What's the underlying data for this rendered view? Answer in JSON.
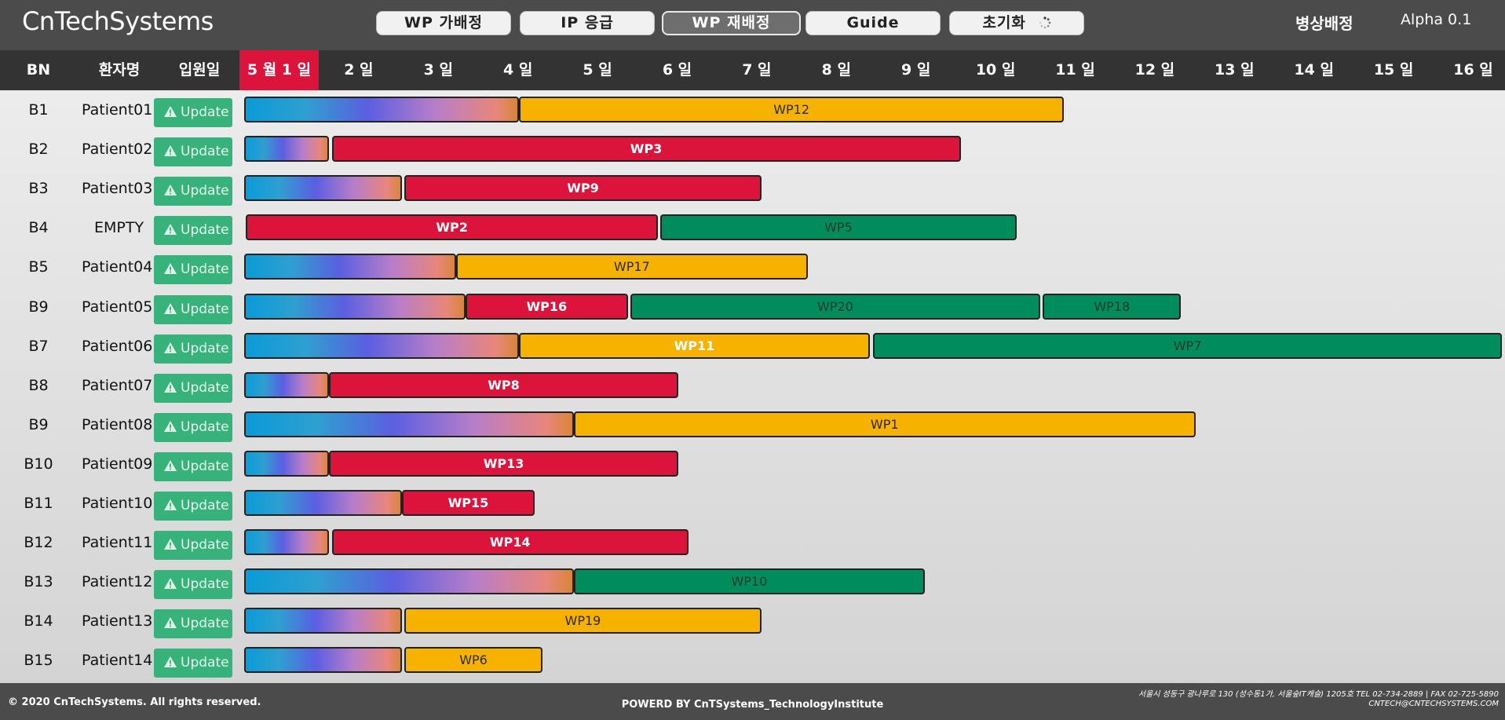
{
  "app": {
    "logo": "CnTechSystems",
    "title": "병상배정",
    "version": "Alpha 0.1"
  },
  "toolbar": {
    "buttons": [
      {
        "label": "WP 가배정",
        "active": false
      },
      {
        "label": "IP 응급",
        "active": false
      },
      {
        "label": "WP 재배정",
        "active": true
      },
      {
        "label": "Guide",
        "active": false
      },
      {
        "label": "초기화",
        "active": false,
        "icon": "spinner-icon"
      }
    ]
  },
  "header": {
    "bn": "BN",
    "patient": "환자명",
    "admit": "입원일",
    "days": [
      "5 월 1 일",
      "2 일",
      "3 일",
      "4 일",
      "5 일",
      "6 일",
      "7 일",
      "8 일",
      "9 일",
      "10 일",
      "11 일",
      "12 일",
      "13 일",
      "14 일",
      "15 일",
      "16 일"
    ],
    "today_index": 0
  },
  "update_label": "Update",
  "rows": [
    {
      "bn": "B1",
      "patient": "Patient01",
      "segments": [
        {
          "type": "grad",
          "start": 0,
          "end": 3.45
        },
        {
          "type": "yellow",
          "label": "WP12",
          "start": 3.45,
          "end": 10.3
        }
      ]
    },
    {
      "bn": "B2",
      "patient": "Patient02",
      "segments": [
        {
          "type": "grad",
          "start": 0,
          "end": 1.07
        },
        {
          "type": "red",
          "label": "WP3",
          "start": 1.1,
          "end": 9.0
        }
      ]
    },
    {
      "bn": "B3",
      "patient": "Patient03",
      "segments": [
        {
          "type": "grad",
          "start": 0,
          "end": 1.98
        },
        {
          "type": "red",
          "label": "WP9",
          "start": 2.01,
          "end": 6.5
        }
      ]
    },
    {
      "bn": "B4",
      "patient": "EMPTY",
      "segments": [
        {
          "type": "red",
          "label": "WP2",
          "start": 0.02,
          "end": 5.2
        },
        {
          "type": "green",
          "label": "WP5",
          "start": 5.23,
          "end": 9.7
        }
      ]
    },
    {
      "bn": "B5",
      "patient": "Patient04",
      "segments": [
        {
          "type": "grad",
          "start": 0,
          "end": 2.66
        },
        {
          "type": "yellow",
          "label": "WP17",
          "start": 2.66,
          "end": 7.08
        }
      ]
    },
    {
      "bn": "B9",
      "patient": "Patient05",
      "segments": [
        {
          "type": "grad",
          "start": 0,
          "end": 2.78
        },
        {
          "type": "red",
          "label": "WP16",
          "start": 2.78,
          "end": 4.82
        },
        {
          "type": "green",
          "label": "WP20",
          "start": 4.85,
          "end": 10.0
        },
        {
          "type": "green",
          "label": "WP18",
          "start": 10.03,
          "end": 11.77
        }
      ]
    },
    {
      "bn": "B7",
      "patient": "Patient06",
      "segments": [
        {
          "type": "grad",
          "start": 0,
          "end": 3.45
        },
        {
          "type": "red",
          "label": "WP11",
          "start": 3.45,
          "end": 7.86,
          "altyellow": true
        },
        {
          "type": "green",
          "label": "WP7",
          "start": 7.9,
          "end": 15.8
        }
      ]
    },
    {
      "bn": "B8",
      "patient": "Patient07",
      "segments": [
        {
          "type": "grad",
          "start": 0,
          "end": 1.07
        },
        {
          "type": "red",
          "label": "WP8",
          "start": 1.07,
          "end": 5.45
        }
      ]
    },
    {
      "bn": "B9",
      "patient": "Patient08",
      "segments": [
        {
          "type": "grad",
          "start": 0,
          "end": 4.14
        },
        {
          "type": "yellow",
          "label": "WP1",
          "start": 4.14,
          "end": 11.95
        }
      ]
    },
    {
      "bn": "B10",
      "patient": "Patient09",
      "segments": [
        {
          "type": "grad",
          "start": 0,
          "end": 1.07
        },
        {
          "type": "red",
          "label": "WP13",
          "start": 1.07,
          "end": 5.45
        }
      ]
    },
    {
      "bn": "B11",
      "patient": "Patient10",
      "segments": [
        {
          "type": "grad",
          "start": 0,
          "end": 1.98
        },
        {
          "type": "red",
          "label": "WP15",
          "start": 1.98,
          "end": 3.65
        }
      ]
    },
    {
      "bn": "B12",
      "patient": "Patient11",
      "segments": [
        {
          "type": "grad",
          "start": 0,
          "end": 1.07
        },
        {
          "type": "red",
          "label": "WP14",
          "start": 1.1,
          "end": 5.58
        }
      ]
    },
    {
      "bn": "B13",
      "patient": "Patient12",
      "segments": [
        {
          "type": "grad",
          "start": 0,
          "end": 4.14
        },
        {
          "type": "green",
          "label": "WP10",
          "start": 4.14,
          "end": 8.55
        }
      ]
    },
    {
      "bn": "B14",
      "patient": "Patient13",
      "segments": [
        {
          "type": "grad",
          "start": 0,
          "end": 1.98
        },
        {
          "type": "yellow",
          "label": "WP19",
          "start": 2.01,
          "end": 6.5
        }
      ]
    },
    {
      "bn": "B15",
      "patient": "Patient14",
      "segments": [
        {
          "type": "grad",
          "start": 0,
          "end": 1.98
        },
        {
          "type": "yellow",
          "label": "WP6",
          "start": 2.01,
          "end": 3.75
        }
      ]
    }
  ],
  "colors": {
    "red": "#dc143c",
    "yellow": "#f7b200",
    "green": "#008c5c",
    "update": "#37b27b",
    "topbar": "#4b4b4b",
    "header": "#333333"
  },
  "footer": {
    "copyright": "© 2020 CnTechSystems. All rights reserved.",
    "powered": "POWERD BY CnTSystems_TechnologyInstitute",
    "address_line1": "서울시 성동구 광나루로 130 (성수동1가, 서울숲IT캐슬) 1205호 TEL 02-734-2889 | FAX 02-725-5890",
    "address_line2": "CNTECH@CNTECHSYSTEMS.COM"
  }
}
